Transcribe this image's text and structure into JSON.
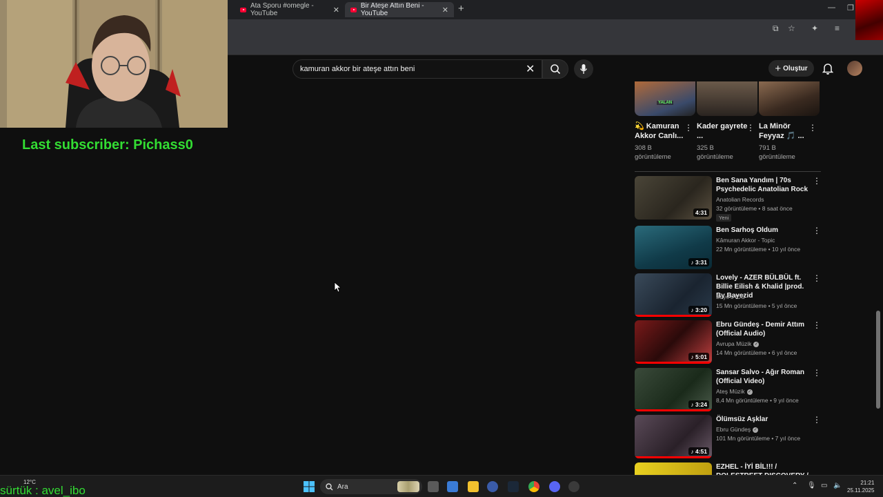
{
  "browser": {
    "tabs": [
      {
        "label": "Ata Sporu #omegle - YouTube",
        "active": false
      },
      {
        "label": "Bir Ateşe Attın Beni - YouTube",
        "active": true
      }
    ]
  },
  "youtube": {
    "search": {
      "query": "kamuran akkor bir ateşe attın beni",
      "placeholder": "Ara"
    },
    "create_label": "Oluştur"
  },
  "overlay": {
    "last_subscriber": "Last subscriber: Pichass0",
    "chat_line": "sürtük : avel_ibo"
  },
  "shorts": [
    {
      "title": "💫 Kamuran Akkor Canlı...",
      "views_line1": "308 B",
      "views_line2": "görüntüleme",
      "tag": "YALAN"
    },
    {
      "title": "Kader gayrete ...",
      "views_line1": "325 B",
      "views_line2": "görüntüleme"
    },
    {
      "title": "La Minör Feyyaz 🎵 ...",
      "views_line1": "791 B",
      "views_line2": "görüntüleme"
    }
  ],
  "videos": [
    {
      "title": "Ben Sana Yandım | 70s Psychedelic Anatolian Rock",
      "channel": "Anatolian Records",
      "verified": false,
      "meta": "32 görüntüleme • 8 saat önce",
      "badge": "Yeni",
      "duration": "4:31",
      "music": false,
      "progress": 0
    },
    {
      "title": "Ben Sarhoş Oldum",
      "channel": "Kâmuran Akkor - Topic",
      "verified": false,
      "meta": "22 Mn görüntüleme • 10 yıl önce",
      "duration": "3:31",
      "music": true,
      "progress": 0
    },
    {
      "title": "Lovely - AZER BÜLBÜL ft. Billie Eilish & Khalid |prod. By Bayezid",
      "channel": "Baye's IDS",
      "verified": false,
      "meta": "15 Mn görüntüleme • 5 yıl önce",
      "duration": "3:20",
      "music": true,
      "progress": 1.0
    },
    {
      "title": "Ebru Gündeş - Demir Attım (Official Audio)",
      "channel": "Avrupa Müzik",
      "verified": true,
      "meta": "14 Mn görüntüleme • 6 yıl önce",
      "duration": "5:01",
      "music": true,
      "progress": 1.0
    },
    {
      "title": "Sansar Salvo - Ağır Roman (Official Video)",
      "channel": "Ateş Müzik",
      "verified": true,
      "meta": "8,4 Mn görüntüleme • 9 yıl önce",
      "duration": "3:24",
      "music": true,
      "progress": 1.0
    },
    {
      "title": "Ölümsüz Aşklar",
      "channel": "Ebru Gündeş",
      "verified": true,
      "meta": "101 Mn görüntüleme • 7 yıl önce",
      "duration": "4:51",
      "music": true,
      "progress": 1.0
    },
    {
      "title": "EZHEL - İYİ BİL!!! / ROLESTREET DISCOVERY / SOUNDS GOOD!!",
      "channel": "",
      "verified": false,
      "meta": "",
      "duration": "",
      "music": false,
      "progress": 0
    }
  ],
  "taskbar": {
    "weather": "12°C",
    "search_placeholder": "Ara",
    "time": "21:21",
    "date": "25.11.2025"
  },
  "colors": {
    "overlay_green": "#33dd33",
    "yt_red": "#ff0033"
  }
}
